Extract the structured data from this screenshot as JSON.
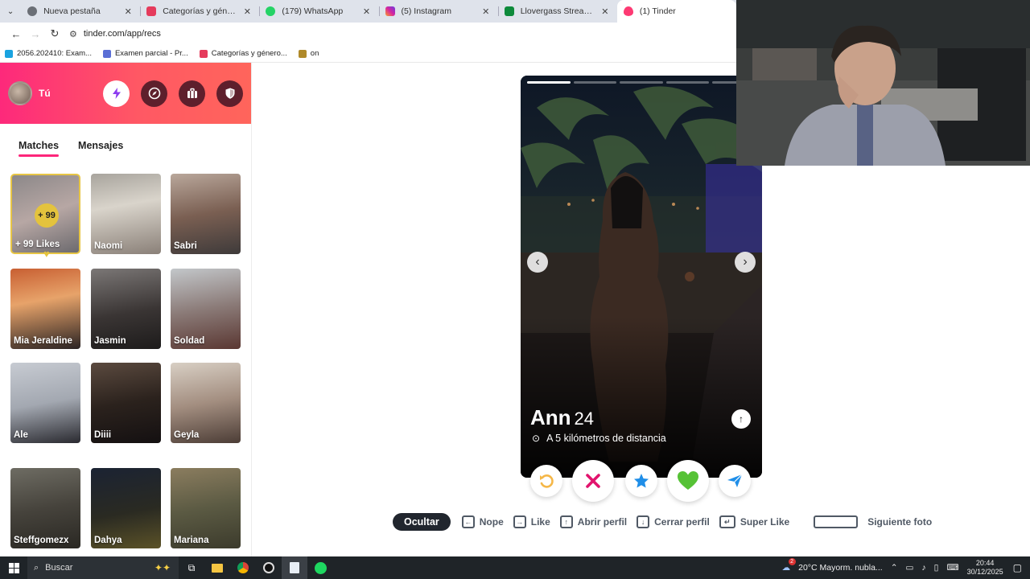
{
  "browser": {
    "tabs": [
      {
        "title": "Nueva pestaña",
        "favicon_color": "#6b6f76"
      },
      {
        "title": "Categorías y géneros musicales",
        "favicon_color": "#e53b5c"
      },
      {
        "title": "(179) WhatsApp",
        "favicon_color": "#25d366"
      },
      {
        "title": "(5) Instagram",
        "favicon_color": "#d6249f"
      },
      {
        "title": "Llovergass Stream - Watch Live",
        "favicon_color": "#0e8a3b"
      },
      {
        "title": "(1) Tinder",
        "favicon_color": "#fd3a73"
      }
    ],
    "url": "tinder.com/app/recs",
    "bookmarks": [
      {
        "label": "2056.202410: Exam...",
        "color": "#1aa3e0"
      },
      {
        "label": "Examen parcial - Pr...",
        "color": "#5b6fd6"
      },
      {
        "label": "Categorías y género...",
        "color": "#e53b5c"
      },
      {
        "label": "on",
        "color": "#b08a2a"
      }
    ]
  },
  "sidebar": {
    "user_label": "Tú",
    "tabs": {
      "matches": "Matches",
      "messages": "Mensajes"
    },
    "likes": {
      "badge": "+ 99",
      "label": "+ 99 Likes"
    },
    "matches": [
      {
        "name": "Naomi"
      },
      {
        "name": "Sabri"
      },
      {
        "name": "Mia Jeraldine"
      },
      {
        "name": "Jasmin"
      },
      {
        "name": "Soldad"
      },
      {
        "name": "Ale"
      },
      {
        "name": "Diiii"
      },
      {
        "name": "Geyla"
      },
      {
        "name": "Steffgomezx"
      },
      {
        "name": "Dahya"
      },
      {
        "name": "Mariana"
      }
    ]
  },
  "profile": {
    "name": "Ann",
    "age": "24",
    "distance": "A 5 kilómetros de distancia",
    "photo_count": 5,
    "current_photo": 1
  },
  "shortcuts": {
    "hide": "Ocultar",
    "nope": "Nope",
    "like": "Like",
    "open_profile": "Abrir perfil",
    "close_profile": "Cerrar perfil",
    "super_like": "Super Like",
    "next_photo": "Siguiente foto"
  },
  "taskbar": {
    "search_placeholder": "Buscar",
    "weather": "20°C  Mayorm. nubla...",
    "weather_badge": "2",
    "time": "20:44",
    "date": "30/12/2025"
  },
  "colors": {
    "tinder_accent": "#fd267a",
    "likes_gold": "#e4c33d"
  }
}
